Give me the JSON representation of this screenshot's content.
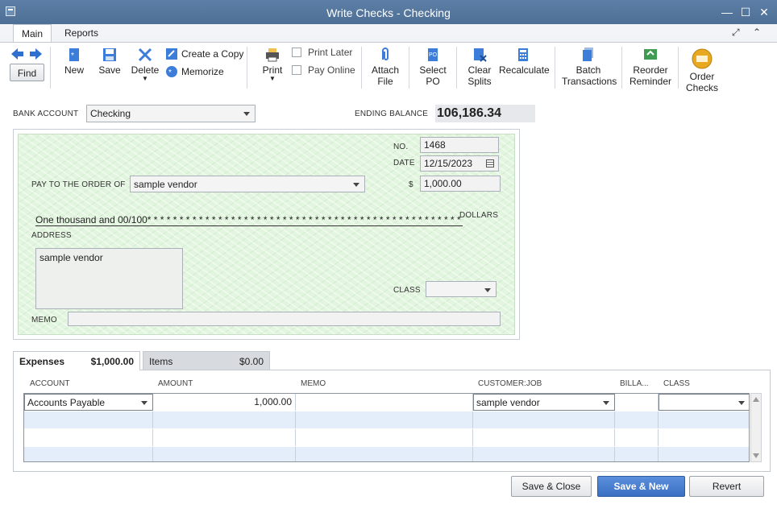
{
  "window": {
    "title": "Write Checks - Checking",
    "minimize": "—",
    "maximize": "☐",
    "close": "✕"
  },
  "ribbon": {
    "tabs": [
      "Main",
      "Reports"
    ],
    "find": "Find",
    "new": "New",
    "save": "Save",
    "delete": "Delete",
    "create_copy": "Create a Copy",
    "memorize": "Memorize",
    "print": "Print",
    "print_later": "Print Later",
    "pay_online": "Pay Online",
    "attach_file": [
      "Attach",
      "File"
    ],
    "select_po": [
      "Select",
      "PO"
    ],
    "clear_splits": [
      "Clear",
      "Splits"
    ],
    "recalculate": "Recalculate",
    "batch_transactions": [
      "Batch",
      "Transactions"
    ],
    "reorder_reminder": [
      "Reorder",
      "Reminder"
    ],
    "order_checks": [
      "Order",
      "Checks"
    ]
  },
  "header": {
    "bank_account_label": "BANK ACCOUNT",
    "bank_account_value": "Checking",
    "ending_balance_label": "ENDING BALANCE",
    "ending_balance_value": "106,186.34"
  },
  "check": {
    "no_label": "NO.",
    "no_value": "1468",
    "date_label": "DATE",
    "date_value": "12/15/2023",
    "pay_to_label": "PAY TO THE ORDER OF",
    "pay_to_value": "sample vendor",
    "dollar_sign": "$",
    "amount_value": "1,000.00",
    "amount_words": "One thousand  and 00/100* * * * * * * * * * * * * * * * * * * * * * * * * * * * * * * * * * * * * * * * * * * * * * * * * * * * * * * * * * *",
    "dollars_label": "DOLLARS",
    "address_label": "ADDRESS",
    "address_value": "sample vendor",
    "class_label": "CLASS",
    "class_value": "",
    "memo_label": "MEMO",
    "memo_value": ""
  },
  "splits": {
    "expenses_tab": "Expenses",
    "expenses_amount": "$1,000.00",
    "items_tab": "Items",
    "items_amount": "$0.00",
    "columns": [
      "ACCOUNT",
      "AMOUNT",
      "MEMO",
      "CUSTOMER:JOB",
      "BILLA...",
      "CLASS"
    ],
    "rows": [
      {
        "account": "Accounts Payable",
        "amount": "1,000.00",
        "memo": "",
        "customer_job": "sample vendor",
        "billable": "",
        "class": ""
      }
    ]
  },
  "footer": {
    "save_close": "Save & Close",
    "save_new": "Save & New",
    "revert": "Revert"
  }
}
